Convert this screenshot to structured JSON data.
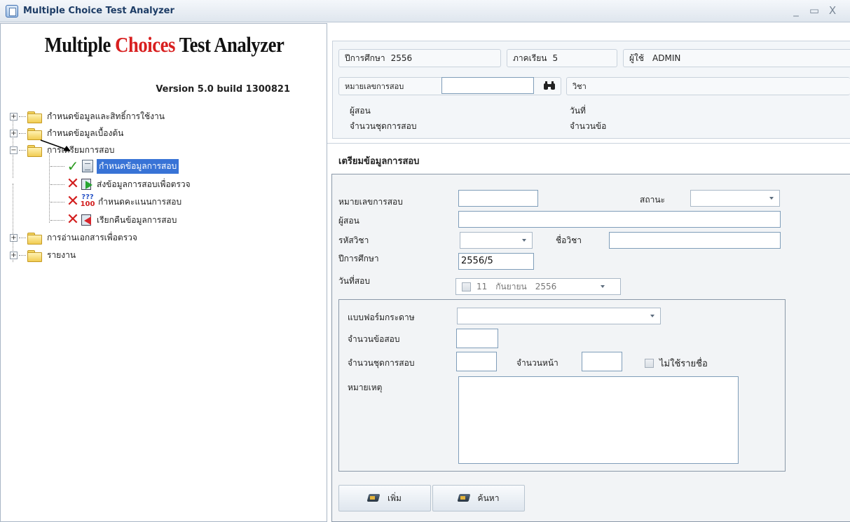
{
  "window": {
    "title": "Multiple Choice Test Analyzer",
    "minimize_glyph": "_",
    "maximize_glyph": "▭",
    "close_glyph": "X"
  },
  "logo": {
    "part1": "Multiple ",
    "part2": "Choices",
    "part3": " Test Analyzer",
    "version": "Version 5.0  build 1300821"
  },
  "tree": {
    "items": [
      {
        "label": "กำหนดข้อมูลและสิทธิ์การใช้งาน",
        "expander": "+"
      },
      {
        "label": "กำหนดข้อมูลเบื้องต้น",
        "expander": "+"
      },
      {
        "label": "การเตรียมการสอบ",
        "expander": "−"
      },
      {
        "label": "กำหนดข้อมูลการสอบ",
        "status": "done",
        "selected": true
      },
      {
        "label": "ส่งข้อมูลการสอบเพื่อตรวจ",
        "status": "pending"
      },
      {
        "label": "กำหนดคะแนนการสอบ",
        "status": "pending",
        "icon_top": "???",
        "icon_bottom": "100"
      },
      {
        "label": "เรียกคืนข้อมูลการสอบ",
        "status": "pending"
      },
      {
        "label": "การอ่านเอกสารเพื่อตรวจ",
        "expander": "+"
      },
      {
        "label": "รายงาน",
        "expander": "+"
      }
    ]
  },
  "info": {
    "year_label": "ปีการศึกษา",
    "year_value": "2556",
    "term_label": "ภาคเรียน",
    "term_value": "5",
    "user_label": "ผู้ใช้",
    "user_value": "ADMIN",
    "exam_no_label": "หมายเลขการสอบ",
    "exam_no_value": "",
    "subject_label": "วิชา",
    "teacher_label": "ผู้สอน",
    "date_label": "วันที่",
    "sets_label": "จำนวนชุดการสอบ",
    "items_label": "จำนวนข้อ"
  },
  "form": {
    "section_title": "เตรียมข้อมูลการสอบ",
    "exam_no_label": "หมายเลขการสอบ",
    "exam_no_value": "",
    "status_label": "สถานะ",
    "status_value": "",
    "teacher_label": "ผู้สอน",
    "teacher_value": "",
    "subject_code_label": "รหัสวิชา",
    "subject_code_value": "",
    "subject_name_label": "ชื่อวิชา",
    "subject_name_value": "",
    "year_label": "ปีการศึกษา",
    "year_value": "2556/5",
    "exam_date_label": "วันที่สอบ",
    "exam_date_day": "11",
    "exam_date_month": "กันยายน",
    "exam_date_year": "2556",
    "paper_form_label": "แบบฟอร์มกระดาษ",
    "paper_form_value": "",
    "num_items_label": "จำนวนข้อสอบ",
    "num_items_value": "",
    "num_sets_label": "จำนวนชุดการสอบ",
    "num_sets_value": "",
    "num_pages_label": "จำนวนหน้า",
    "num_pages_value": "",
    "no_names_label": "ไม่ใช้รายชื่อ",
    "notes_label": "หมายเหตุ",
    "notes_value": ""
  },
  "buttons": {
    "add_label": "เพิ่ม",
    "search_label": "ค้นหา"
  }
}
